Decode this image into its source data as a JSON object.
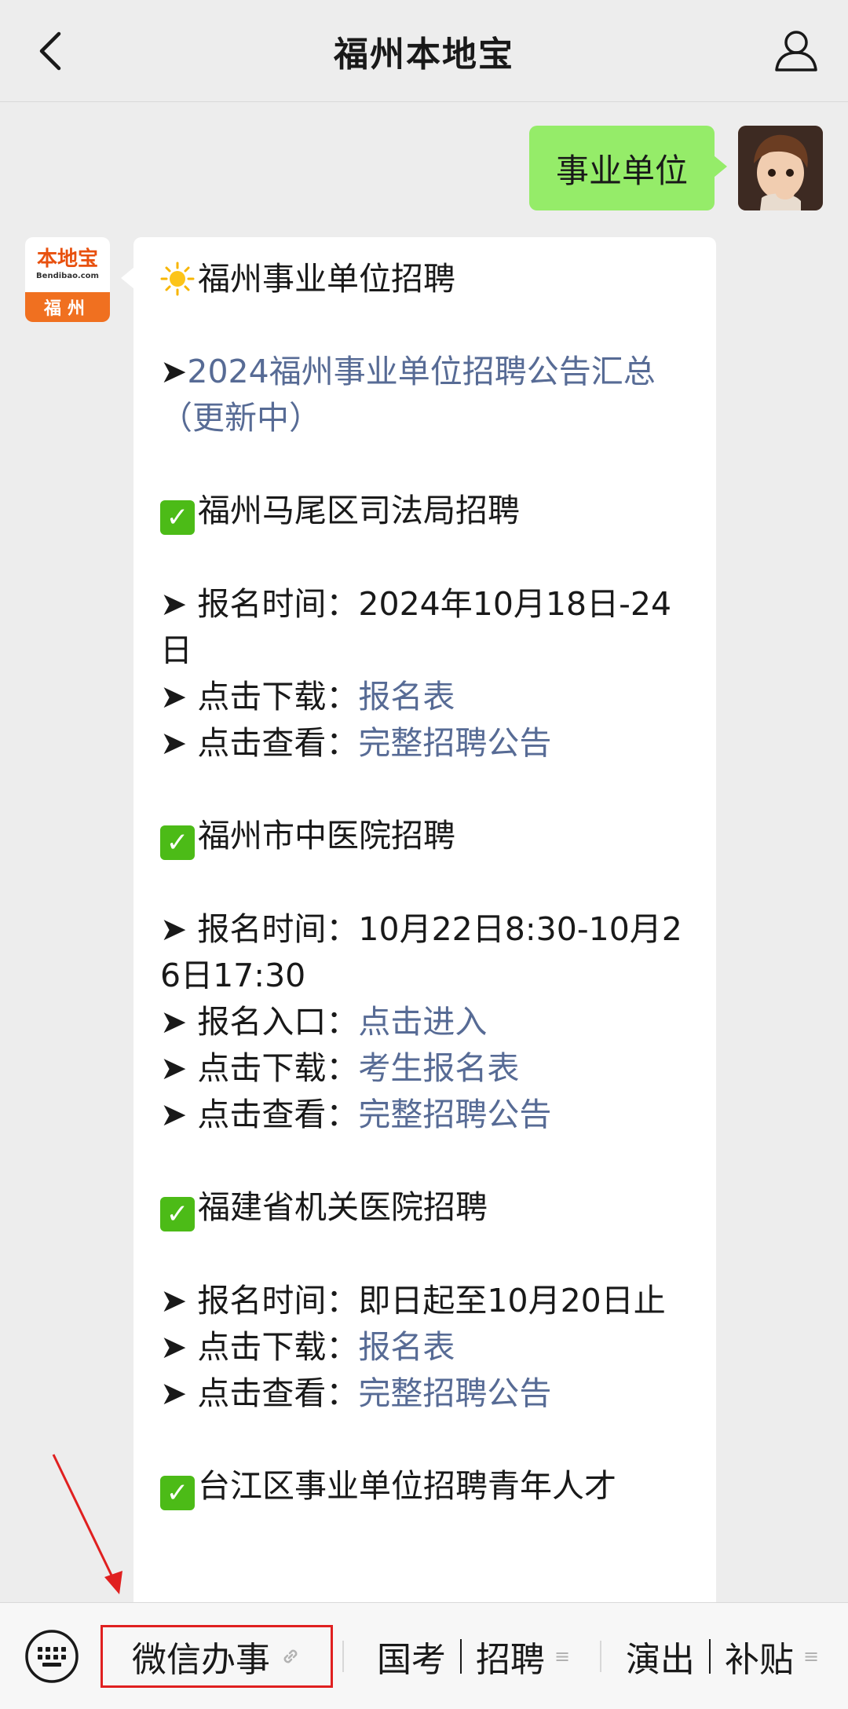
{
  "header": {
    "title": "福州本地宝"
  },
  "user_message": {
    "text": "事业单位"
  },
  "bot": {
    "avatar_brand": "本地宝",
    "avatar_site": "Bendibao.com",
    "avatar_city": "福州",
    "lines": {
      "title": "福州事业单位招聘",
      "summary_link": "2024福州事业单位招聘公告汇总（更新中）",
      "s1_title": "福州马尾区司法局招聘",
      "s1_time_label": " 报名时间：",
      "s1_time_value": "2024年10月18日-24日",
      "s1_download_label": " 点击下载：",
      "s1_download_link": "报名表",
      "s1_view_label": " 点击查看：",
      "s1_view_link": "完整招聘公告",
      "s2_title": "福州市中医院招聘",
      "s2_time_label": " 报名时间：",
      "s2_time_value": "10月22日8:30-10月26日17:30",
      "s2_entry_label": " 报名入口：",
      "s2_entry_link": "点击进入",
      "s2_download_label": " 点击下载：",
      "s2_download_link": "考生报名表",
      "s2_view_label": " 点击查看：",
      "s2_view_link": "完整招聘公告",
      "s3_title": "福建省机关医院招聘",
      "s3_time_label": " 报名时间：",
      "s3_time_value": "即日起至10月20日止",
      "s3_download_label": " 点击下载：",
      "s3_download_link": "报名表",
      "s3_view_label": " 点击查看：",
      "s3_view_link": "完整招聘公告",
      "s4_title": "台江区事业单位招聘青年人才"
    }
  },
  "menu": {
    "item1": "微信办事",
    "item2a": "国考",
    "item2b": "招聘",
    "item3a": "演出",
    "item3b": "补贴"
  },
  "colors": {
    "link": "#576b95",
    "user_bubble": "#95ec69",
    "highlight": "#e02020"
  }
}
